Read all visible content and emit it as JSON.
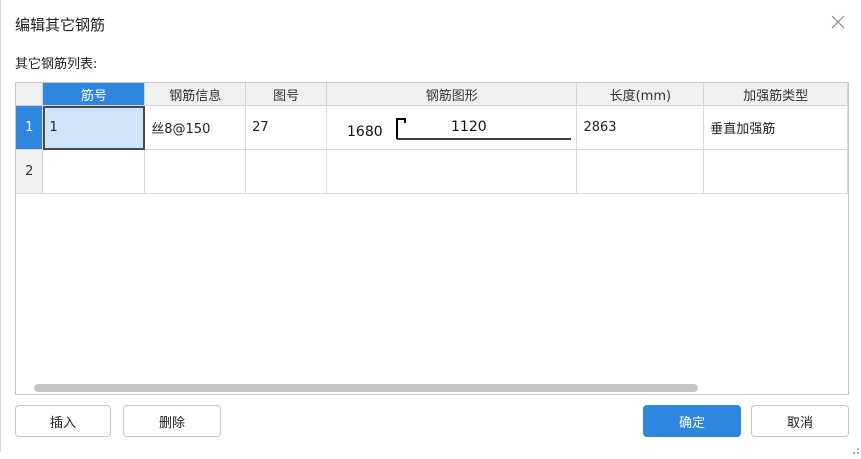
{
  "dialog": {
    "title": "编辑其它钢筋",
    "list_label": "其它钢筋列表:"
  },
  "table": {
    "columns": [
      "筋号",
      "钢筋信息",
      "图号",
      "钢筋图形",
      "长度(mm)",
      "加强筋类型"
    ],
    "selected_column": 0,
    "rows": [
      {
        "row_no": "1",
        "jin_hao": "1",
        "info": "丝8@150",
        "fig_no": "27",
        "shape": {
          "left_value": "1680",
          "top_value": "1120"
        },
        "length": "2863",
        "type": "垂直加强筋"
      },
      {
        "row_no": "2",
        "jin_hao": "",
        "info": "",
        "fig_no": "",
        "shape": {
          "left_value": "",
          "top_value": ""
        },
        "length": "",
        "type": ""
      }
    ]
  },
  "buttons": {
    "insert": "插入",
    "delete": "删除",
    "ok": "确定",
    "cancel": "取消"
  },
  "colors": {
    "accent": "#2e86de",
    "selected_cell": "#cfe3fb"
  },
  "icons": {
    "close": "close-icon",
    "resize": "resize-grip-icon"
  }
}
